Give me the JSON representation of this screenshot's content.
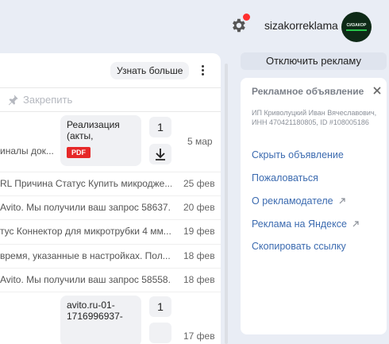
{
  "header": {
    "username": "sizakorreklama",
    "avatar_label": "СИЗАКОР"
  },
  "mail": {
    "learn_more_label": "Узнать больше",
    "pin_label": "Закрепить",
    "rows": [
      {
        "snippet": "иналы док...",
        "date": "5 мар",
        "attachment_name": "Реализация (акты,",
        "attachment_badge": "PDF",
        "attachment_count": "1"
      },
      {
        "snippet": "RL Причина Статус Купить микродже...",
        "date": "25 фев"
      },
      {
        "snippet": "Avito. Мы получили ваш запрос 58637...",
        "date": "20 фев"
      },
      {
        "snippet": "тус Коннектор для микротрубки 4 мм...",
        "date": "19 фев"
      },
      {
        "snippet": "время, указанные в настройках. Пол...",
        "date": "18 фев"
      },
      {
        "snippet": "Avito. Мы получили ваш запрос 58558...",
        "date": "18 фев"
      },
      {
        "snippet": "",
        "date": "17 фев",
        "attachment_name": "avito.ru-01-1716996937-",
        "attachment_count": "1"
      }
    ]
  },
  "ad": {
    "disable_label": "Отключить рекламу",
    "title": "Рекламное объявление",
    "info": "ИП Криволуцкий Иван Вячеславович, ИНН 470421180805, ID #108005186",
    "links": [
      {
        "label": "Скрыть объявление",
        "external": false
      },
      {
        "label": "Пожаловаться",
        "external": false
      },
      {
        "label": "О рекламодателе",
        "external": true
      },
      {
        "label": "Реклама на Яндексе",
        "external": true
      },
      {
        "label": "Скопировать ссылку",
        "external": false
      }
    ]
  },
  "colors": {
    "accent_link": "#3c6bb0",
    "pdf_badge": "#e62828",
    "notification_dot": "#ff2f2f"
  }
}
